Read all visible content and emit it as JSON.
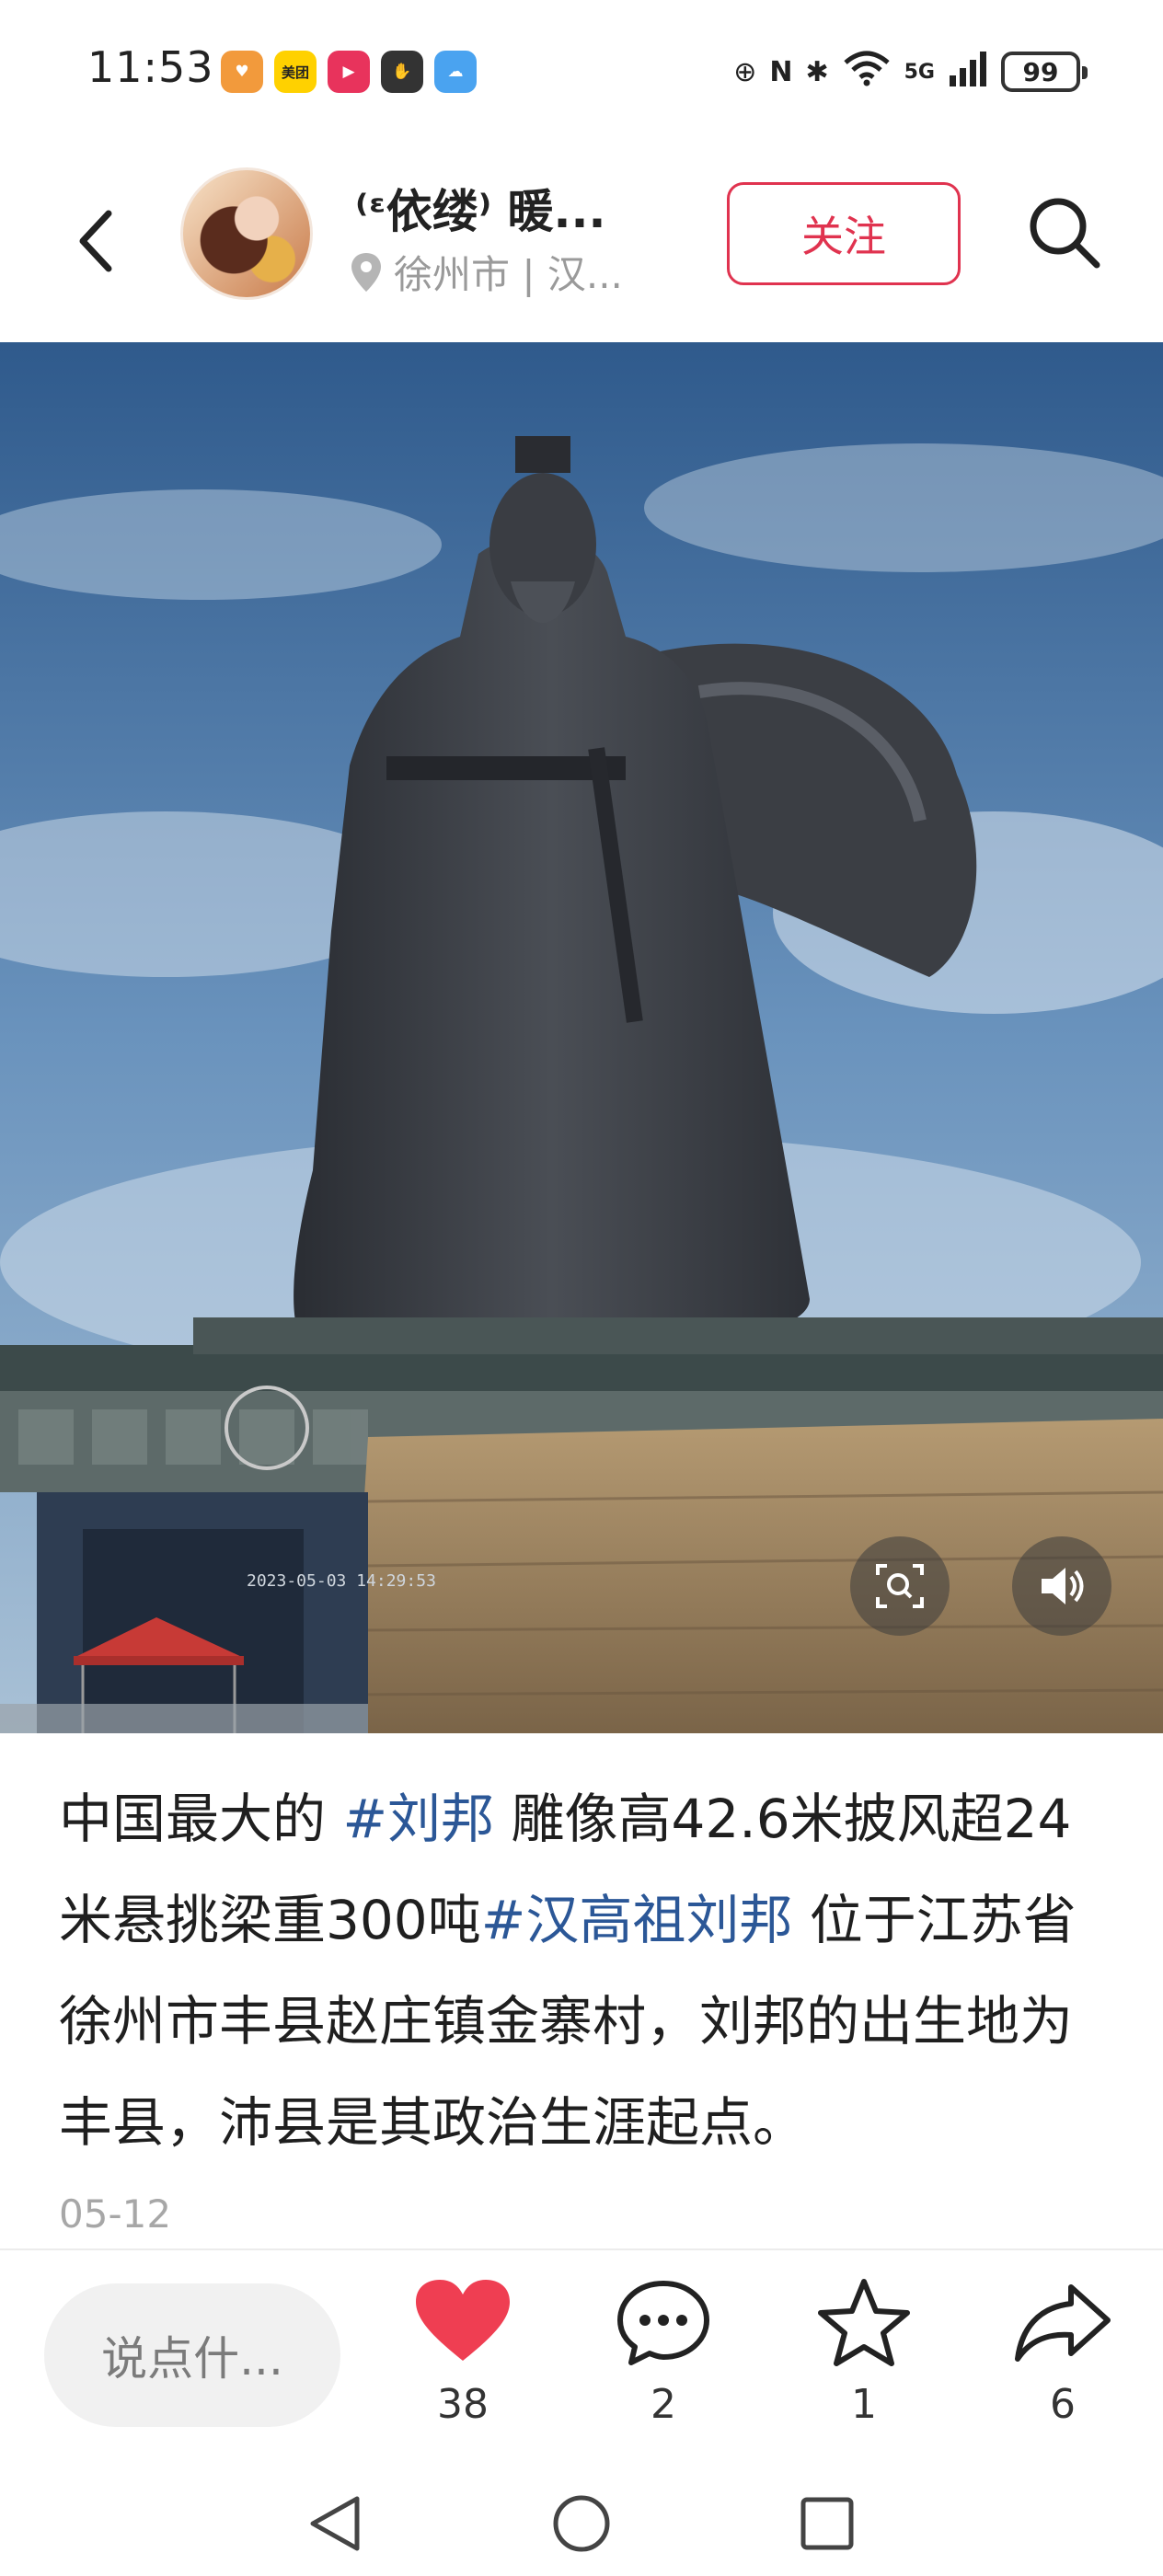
{
  "status_bar": {
    "time": "11:53",
    "apps": [
      {
        "name": "heart-app",
        "color": "#f29a3c",
        "glyph": "♥"
      },
      {
        "name": "meituan-app",
        "color": "#ffd100",
        "glyph": "美团"
      },
      {
        "name": "video-app",
        "color": "#e8335c",
        "glyph": "▶"
      },
      {
        "name": "hand-app",
        "color": "#333333",
        "glyph": "✋"
      },
      {
        "name": "weather-app",
        "color": "#4aa3f0",
        "glyph": "☁"
      }
    ],
    "network": "5G",
    "battery": "99"
  },
  "header": {
    "user_name": "⁽ᵋ依缕⁾ 暖...",
    "location": "徐州市 | 汉...",
    "follow_label": "关注"
  },
  "post": {
    "caption_parts": [
      {
        "text": "中国最大的 ",
        "tag": false
      },
      {
        "text": "#刘邦",
        "tag": true
      },
      {
        "text": " 雕像高42.6米披风超24米悬挑梁重300吨",
        "tag": false
      },
      {
        "text": "#汉高祖刘邦",
        "tag": true
      },
      {
        "text": " 位于江苏省徐州市丰县赵庄镇金寨村，刘邦的出生地为丰县，沛县是其政治生涯起点。",
        "tag": false
      }
    ],
    "date": "05-12",
    "photo_overlay_text": "2023-05-03 14:29:53"
  },
  "actions": {
    "comment_placeholder": "说点什...",
    "like_count": "38",
    "comment_count": "2",
    "favorite_count": "1",
    "share_count": "6"
  },
  "colors": {
    "accent": "#e0334f",
    "hashtag": "#2b5797",
    "like": "#ef3e52"
  }
}
